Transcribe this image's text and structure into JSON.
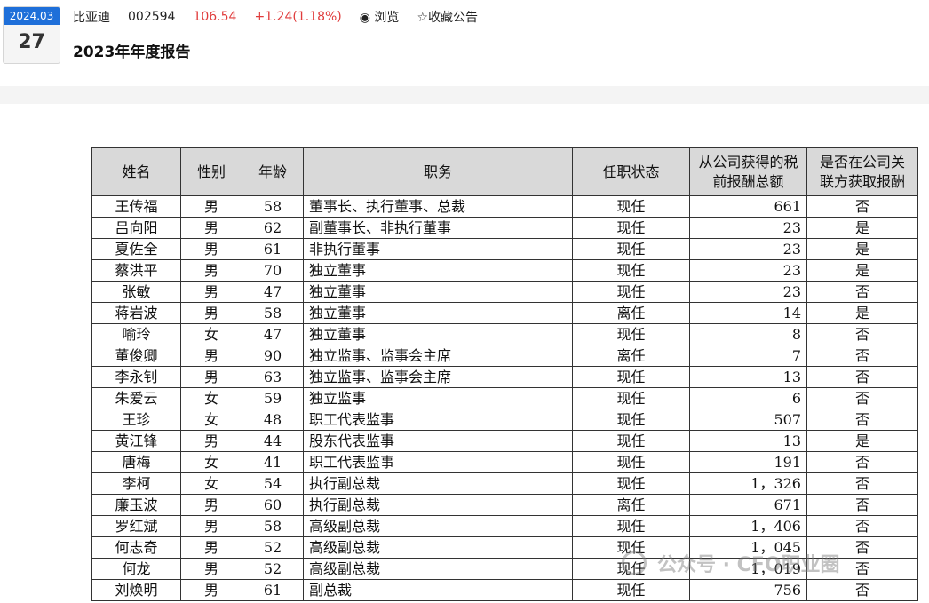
{
  "date_badge": {
    "year_month": "2024.03",
    "day": "27"
  },
  "header": {
    "stock_name": "比亚迪",
    "stock_code": "002594",
    "price": "106.54",
    "change": "+1.24(1.18%)",
    "browse_label": "◉ 浏览",
    "favorite_label": "☆收藏公告"
  },
  "doc_title": "2023年年度报告",
  "table": {
    "headers": [
      "姓名",
      "性别",
      "年龄",
      "职务",
      "任职状态",
      "从公司获得的税前报酬总额",
      "是否在公司关联方获取报酬"
    ],
    "rows": [
      [
        "王传福",
        "男",
        "58",
        "董事长、执行董事、总裁",
        "现任",
        "661",
        "否"
      ],
      [
        "吕向阳",
        "男",
        "62",
        "副董事长、非执行董事",
        "现任",
        "23",
        "是"
      ],
      [
        "夏佐全",
        "男",
        "61",
        "非执行董事",
        "现任",
        "23",
        "是"
      ],
      [
        "蔡洪平",
        "男",
        "70",
        "独立董事",
        "现任",
        "23",
        "是"
      ],
      [
        "张敏",
        "男",
        "47",
        "独立董事",
        "现任",
        "23",
        "否"
      ],
      [
        "蒋岩波",
        "男",
        "58",
        "独立董事",
        "离任",
        "14",
        "是"
      ],
      [
        "喻玲",
        "女",
        "47",
        "独立董事",
        "现任",
        "8",
        "否"
      ],
      [
        "董俊卿",
        "男",
        "90",
        "独立监事、监事会主席",
        "离任",
        "7",
        "否"
      ],
      [
        "李永钊",
        "男",
        "63",
        "独立监事、监事会主席",
        "现任",
        "13",
        "否"
      ],
      [
        "朱爱云",
        "女",
        "59",
        "独立监事",
        "现任",
        "6",
        "否"
      ],
      [
        "王珍",
        "女",
        "48",
        "职工代表监事",
        "现任",
        "507",
        "否"
      ],
      [
        "黄江锋",
        "男",
        "44",
        "股东代表监事",
        "现任",
        "13",
        "是"
      ],
      [
        "唐梅",
        "女",
        "41",
        "职工代表监事",
        "现任",
        "191",
        "否"
      ],
      [
        "李柯",
        "女",
        "54",
        "执行副总裁",
        "现任",
        "1，326",
        "否"
      ],
      [
        "廉玉波",
        "男",
        "60",
        "执行副总裁",
        "离任",
        "671",
        "否"
      ],
      [
        "罗红斌",
        "男",
        "58",
        "高级副总裁",
        "现任",
        "1，406",
        "否"
      ],
      [
        "何志奇",
        "男",
        "52",
        "高级副总裁",
        "现任",
        "1，045",
        "否"
      ],
      [
        "何龙",
        "男",
        "52",
        "高级副总裁",
        "现任",
        "1，019",
        "否"
      ],
      [
        "刘焕明",
        "男",
        "61",
        "副总裁",
        "现任",
        "756",
        "否"
      ]
    ]
  },
  "watermark": "公众号 · CFO职业圈"
}
